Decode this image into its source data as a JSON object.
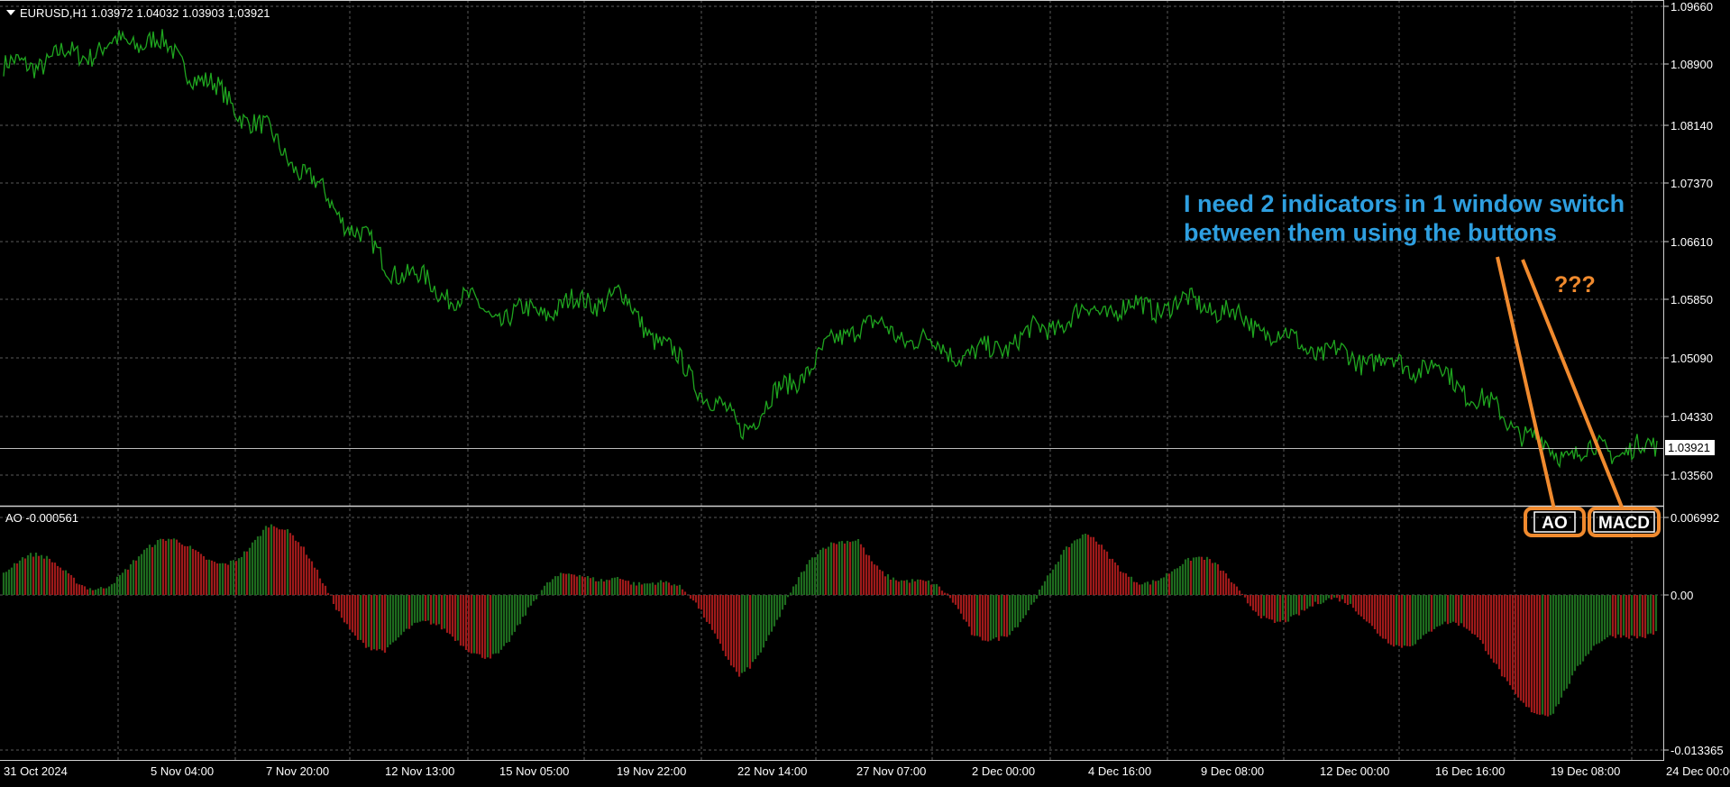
{
  "chart": {
    "symbol_line": "EURUSD,H1  1.03972 1.04032 1.03903 1.03921",
    "price_axis": [
      "1.09660",
      "1.08900",
      "1.08140",
      "1.07370",
      "1.06610",
      "1.05850",
      "1.05090",
      "1.04330",
      "1.03560"
    ],
    "current_price": "1.03921",
    "time_axis": [
      "31 Oct 2024",
      "5 Nov 04:00",
      "7 Nov 20:00",
      "12 Nov 13:00",
      "15 Nov 05:00",
      "19 Nov 22:00",
      "22 Nov 14:00",
      "27 Nov 07:00",
      "2 Dec 00:00",
      "4 Dec 16:00",
      "9 Dec 08:00",
      "12 Dec 00:00",
      "16 Dec 16:00",
      "19 Dec 08:00",
      "24 Dec 00:00"
    ]
  },
  "indicator": {
    "label": "AO -0.000561",
    "axis": [
      "0.006992",
      "0.00",
      "-0.013365"
    ]
  },
  "annotation": {
    "line1": "I need 2 indicators in 1 window switch",
    "line2": "between them using the buttons",
    "question": "???"
  },
  "buttons": {
    "ao": "AO",
    "macd": "MACD"
  },
  "colors": {
    "background": "#000000",
    "grid": "#5a5a5a",
    "price_line": "#1fa51f",
    "ao_up": "#1e6b1e",
    "ao_down": "#9e1a1a",
    "annotation": "#2e9fe0",
    "accent": "#f08a2e"
  },
  "chart_data": [
    {
      "type": "line",
      "title": "EURUSD,H1",
      "x": [
        "31 Oct 2024",
        "5 Nov 04:00",
        "7 Nov 20:00",
        "12 Nov 13:00",
        "15 Nov 05:00",
        "19 Nov 22:00",
        "22 Nov 14:00",
        "27 Nov 07:00",
        "2 Dec 00:00",
        "4 Dec 16:00",
        "9 Dec 08:00",
        "12 Dec 00:00",
        "16 Dec 16:00",
        "19 Dec 08:00",
        "24 Dec 00:00"
      ],
      "values": [
        1.0885,
        1.0925,
        1.08,
        1.063,
        1.056,
        1.059,
        1.0415,
        1.0555,
        1.051,
        1.057,
        1.058,
        1.0515,
        1.0495,
        1.0385,
        1.0392
      ],
      "ylim": [
        1.032,
        1.0966
      ]
    },
    {
      "type": "bar",
      "title": "AO",
      "x": [
        "31 Oct 2024",
        "5 Nov 04:00",
        "7 Nov 20:00",
        "12 Nov 13:00",
        "15 Nov 05:00",
        "19 Nov 22:00",
        "22 Nov 14:00",
        "27 Nov 07:00",
        "2 Dec 00:00",
        "4 Dec 16:00",
        "9 Dec 08:00",
        "12 Dec 00:00",
        "16 Dec 16:00",
        "19 Dec 08:00",
        "24 Dec 00:00"
      ],
      "values": [
        0.0015,
        0.0028,
        0.0055,
        -0.0045,
        -0.0035,
        0.0035,
        -0.0055,
        0.0058,
        -0.004,
        0.004,
        0.0015,
        -0.002,
        -0.003,
        -0.0095,
        -0.0006
      ],
      "ylim": [
        -0.013365,
        0.006992
      ]
    }
  ]
}
